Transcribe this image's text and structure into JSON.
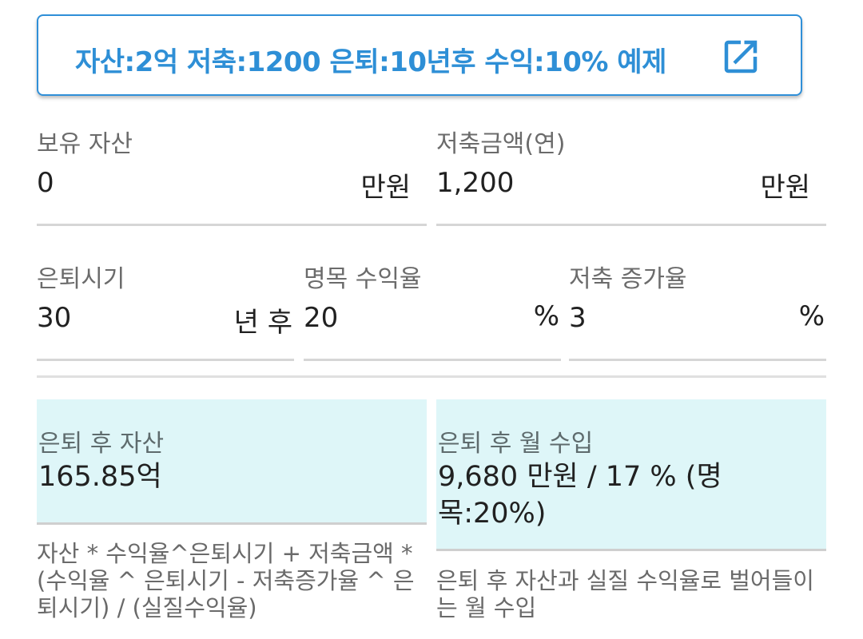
{
  "example_button": {
    "label": "자산:2억 저축:1200 은퇴:10년후 수익:10% 예제",
    "icon": "open-in-new-icon",
    "color": "#2e8fd6"
  },
  "inputs": {
    "assets": {
      "label": "보유 자산",
      "value": "0",
      "unit": "만원"
    },
    "savings": {
      "label": "저축금액(연)",
      "value": "1,200",
      "unit": "만원"
    },
    "retirement": {
      "label": "은퇴시기",
      "value": "30",
      "unit": "년 후"
    },
    "nominal_return": {
      "label": "명목 수익율",
      "value": "20",
      "unit": "%"
    },
    "savings_growth": {
      "label": "저축 증가율",
      "value": "3",
      "unit": "%"
    }
  },
  "results": {
    "assets_after": {
      "label": "은퇴 후 자산",
      "value": "165.85억",
      "helper": "자산 * 수익율^은퇴시기 + 저축금액 * (수익율 ^ 은퇴시기 - 저축증가율 ^ 은퇴시기) / (실질수익율)"
    },
    "monthly_income": {
      "label": "은퇴 후 월 수입",
      "value": "9,680 만원 / 17 % (명목:20%)",
      "helper": "은퇴 후 자산과 실질 수익율로 벌어들이는 월 수입"
    },
    "background_color": "#def6f8"
  }
}
